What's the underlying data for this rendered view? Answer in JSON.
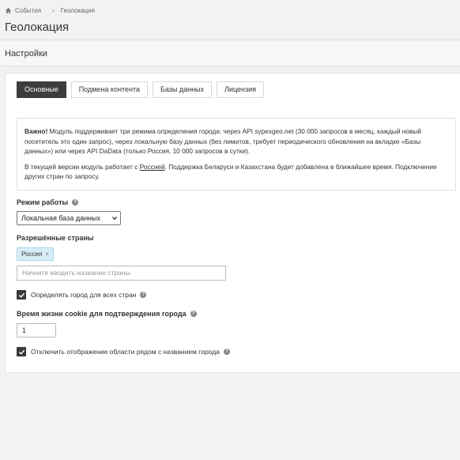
{
  "breadcrumb": {
    "home": "События",
    "current": "Геолокация"
  },
  "page_title": "Геолокация",
  "section_title": "Настройки",
  "tabs": [
    {
      "label": "Основные",
      "active": true
    },
    {
      "label": "Подмена контента",
      "active": false
    },
    {
      "label": "Базы данных",
      "active": false
    },
    {
      "label": "Лицензия",
      "active": false
    }
  ],
  "notice": {
    "bold": "Важно!",
    "p1": " Модуль поддерживает три режима определения города: через API sypexgeo.net (30 000 запросов в месяц, каждый новый посетитель это один запрос), через локальную базу данных (без лимитов, требует периодического обновления на вкладке «Базы данных») или через API DaData (только Россия, 10 000 запросов в сутки).",
    "p2_a": "В текущей версии модуль работает с ",
    "p2_link": "Россией",
    "p2_b": ". Поддержка Беларуси и Казахстана будет добавлена в ближайшее время. Подключение других стран по запросу."
  },
  "mode": {
    "label": "Режим работы",
    "value": "Локальная база данных"
  },
  "countries": {
    "label": "Разрешённые страны",
    "chip": "Россия",
    "placeholder": "Начните вводить название страны"
  },
  "all_countries": {
    "label": "Определять город для всех стран",
    "checked": true
  },
  "cookie": {
    "label": "Время жизни cookie для подтверждения города",
    "value": "1"
  },
  "hide_region": {
    "label": "Отключить отображение области рядом с названием города",
    "checked": true
  },
  "icons": {
    "home": "home-icon",
    "help": "help-icon",
    "check": "check-icon",
    "chevron": "chevron-down-icon",
    "remove": "close-icon"
  }
}
